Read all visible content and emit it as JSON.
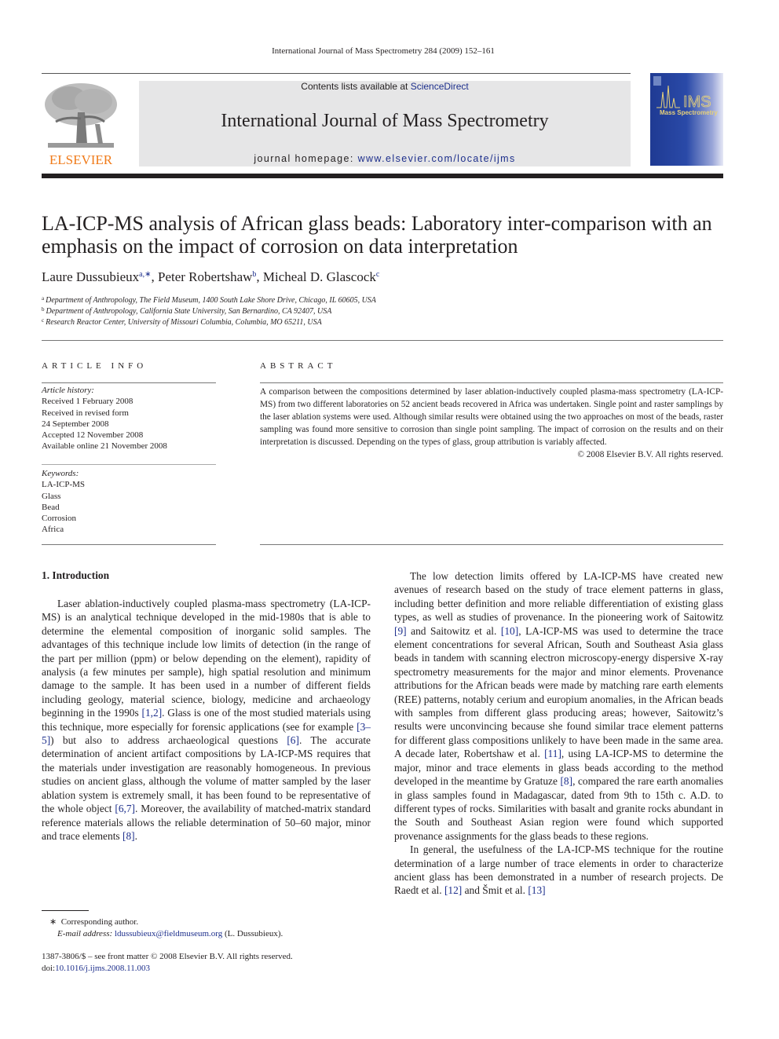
{
  "running_head": "International Journal of Mass Spectrometry 284 (2009) 152–161",
  "masthead": {
    "publisher_logo": "ELSEVIER",
    "contents_prefix": "Contents lists available at ",
    "contents_link": "ScienceDirect",
    "journal_title": "International Journal of Mass Spectrometry",
    "homepage_prefix": "journal homepage: ",
    "homepage_link": "www.elsevier.com/locate/ijms",
    "cover_title": "Mass Spectrometry",
    "cover_logo": "IMS",
    "colors": {
      "publisher_orange": "#f07b1a",
      "link_blue": "#1d2f8c",
      "cover_blue": "#1f3a93",
      "banner_gray": "#e6e6e7"
    }
  },
  "article": {
    "title": "LA-ICP-MS analysis of African glass beads: Laboratory inter-comparison with an emphasis on the impact of corrosion on data interpretation",
    "authors": [
      {
        "name": "Laure Dussubieux",
        "marks": "a,∗"
      },
      {
        "name": "Peter Robertshaw",
        "marks": "b"
      },
      {
        "name": "Micheal D. Glascock",
        "marks": "c"
      }
    ],
    "affiliations": [
      {
        "mark": "a",
        "text": "Department of Anthropology, The Field Museum, 1400 South Lake Shore Drive, Chicago, IL 60605, USA"
      },
      {
        "mark": "b",
        "text": "Department of Anthropology, California State University, San Bernardino, CA 92407, USA"
      },
      {
        "mark": "c",
        "text": "Research Reactor Center, University of Missouri Columbia, Columbia, MO 65211, USA"
      }
    ]
  },
  "article_info": {
    "heading": "ARTICLE INFO",
    "history_label": "Article history:",
    "history": [
      "Received 1 February 2008",
      "Received in revised form",
      "24 September 2008",
      "Accepted 12 November 2008",
      "Available online 21 November 2008"
    ],
    "keywords_label": "Keywords:",
    "keywords": [
      "LA-ICP-MS",
      "Glass",
      "Bead",
      "Corrosion",
      "Africa"
    ]
  },
  "abstract": {
    "heading": "ABSTRACT",
    "text": "A comparison between the compositions determined by laser ablation-inductively coupled plasma-mass spectrometry (LA-ICP-MS) from two different laboratories on 52 ancient beads recovered in Africa was undertaken. Single point and raster samplings by the laser ablation systems were used. Although similar results were obtained using the two approaches on most of the beads, raster sampling was found more sensitive to corrosion than single point sampling. The impact of corrosion on the results and on their interpretation is discussed. Depending on the types of glass, group attribution is variably affected.",
    "copyright": "© 2008 Elsevier B.V. All rights reserved."
  },
  "body": {
    "section_heading": "1.  Introduction",
    "left_paragraph": [
      {
        "t": "Laser ablation-inductively coupled plasma-mass spectrometry (LA-ICP-MS) is an analytical technique developed in the mid-1980s that is able to determine the elemental composition of inorganic solid samples. The advantages of this technique include low limits of detection (in the range of the part per million (ppm) or below depending on the element), rapidity of analysis (a few minutes per sample), high spatial resolution and minimum damage to the sample. It has been used in a number of different fields including geology, material science, biology, medicine and archaeology beginning in the 1990s "
      },
      {
        "ref": "[1,2]"
      },
      {
        "t": ". Glass is one of the most studied materials using this technique, more especially for forensic applications (see for example "
      },
      {
        "ref": "[3–5]"
      },
      {
        "t": ") but also to address archaeological questions "
      },
      {
        "ref": "[6]"
      },
      {
        "t": ". The accurate determination of ancient artifact compositions by LA-ICP-MS requires that the materials under investigation are reasonably homogeneous. In previous studies on ancient glass, although the volume of matter sampled by the laser ablation system is extremely small, it has been found to be representative of the whole object "
      },
      {
        "ref": "[6,7]"
      },
      {
        "t": ". Moreover, the availability of matched-matrix standard reference materials allows the reliable determination of 50–60 major, minor and trace elements "
      },
      {
        "ref": "[8]"
      },
      {
        "t": "."
      }
    ],
    "right_paragraph_1": [
      {
        "t": "The low detection limits offered by LA-ICP-MS have created new avenues of research based on the study of trace element patterns in glass, including better definition and more reliable differentiation of existing glass types, as well as studies of provenance. In the pioneering work of Saitowitz "
      },
      {
        "ref": "[9]"
      },
      {
        "t": " and Saitowitz et al. "
      },
      {
        "ref": "[10]"
      },
      {
        "t": ", LA-ICP-MS was used to determine the trace element concentrations for several African, South and Southeast Asia glass beads in tandem with scanning electron microscopy-energy dispersive X-ray spectrometry measurements for the major and minor elements. Provenance attributions for the African beads were made by matching rare earth elements (REE) patterns, notably cerium and europium anomalies, in the African beads with samples from different glass producing areas; however, Saitowitz’s results were unconvincing because she found similar trace element patterns for different glass compositions unlikely to have been made in the same area. A decade later, Robertshaw et al. "
      },
      {
        "ref": "[11]"
      },
      {
        "t": ", using LA-ICP-MS to determine the major, minor and trace elements in glass beads according to the method developed in the meantime by Gratuze "
      },
      {
        "ref": "[8]"
      },
      {
        "t": ", compared the rare earth anomalies in glass samples found in Madagascar, dated from 9th to 15th c. A.D. to different types of rocks. Similarities with basalt and granite rocks abundant in the South and Southeast Asian region were found which supported provenance assignments for the glass beads to these regions."
      }
    ],
    "right_paragraph_2": [
      {
        "t": "In general, the usefulness of the LA-ICP-MS technique for the routine determination of a large number of trace elements in order to characterize ancient glass has been demonstrated in a number of research projects. De Raedt et al. "
      },
      {
        "ref": "[12]"
      },
      {
        "t": " and Šmit et al. "
      },
      {
        "ref": "[13]"
      }
    ]
  },
  "footnote": {
    "mark": "∗",
    "corresponding": "Corresponding author.",
    "email_label": "E-mail address: ",
    "email": "ldussubieux@fieldmuseum.org",
    "email_suffix": " (L. Dussubieux)."
  },
  "front_matter": {
    "issn_line": "1387-3806/$ – see front matter © 2008 Elsevier B.V. All rights reserved.",
    "doi_prefix": "doi:",
    "doi": "10.1016/j.ijms.2008.11.003"
  }
}
